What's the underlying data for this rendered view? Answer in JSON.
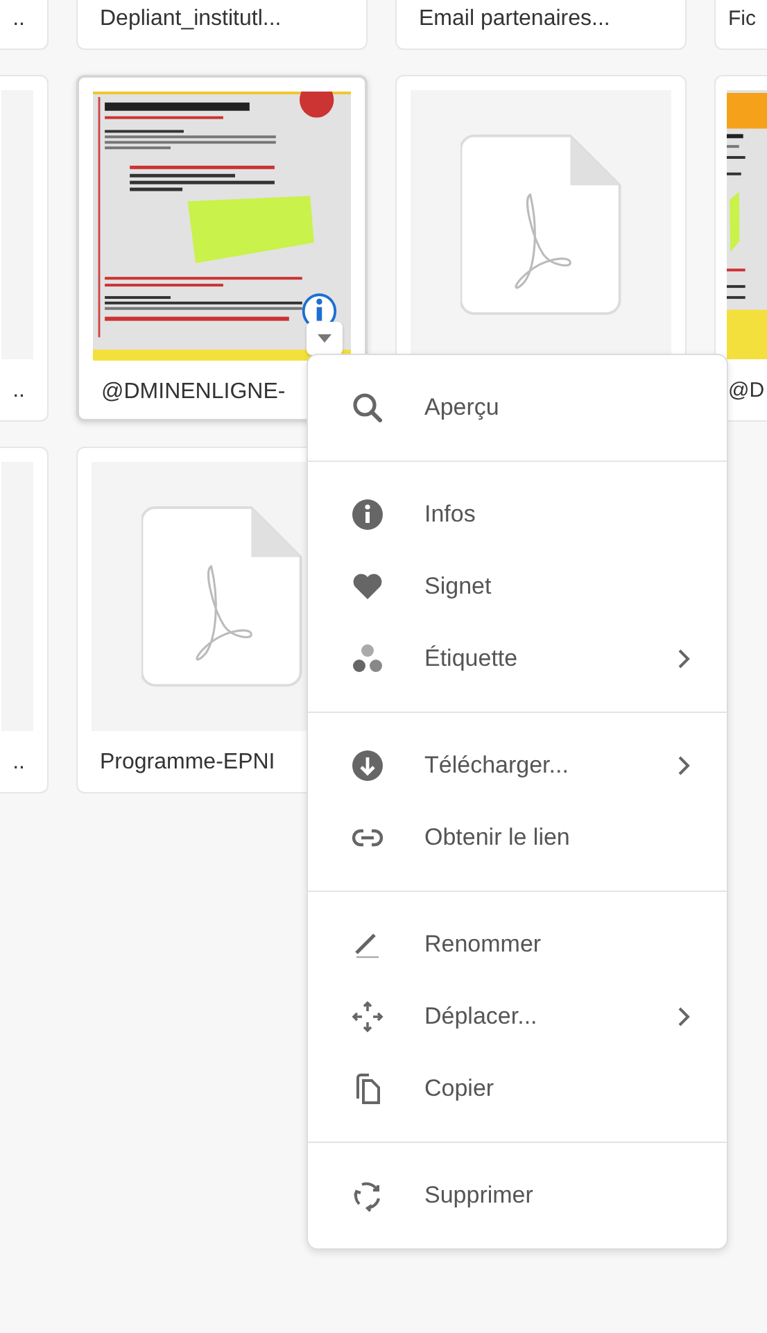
{
  "file_grid": {
    "rows": [
      {
        "cards": [
          {
            "caption": "..",
            "selected": false
          },
          {
            "caption": "Depliant_institutl...",
            "selected": false
          },
          {
            "caption": "Email partenaires...",
            "selected": false
          },
          {
            "caption": "Fic",
            "selected": false
          }
        ]
      },
      {
        "cards": [
          {
            "caption": "..",
            "kind": "blank",
            "selected": false
          },
          {
            "caption": "@DMINENLIGNE-",
            "kind": "poster",
            "selected": true
          },
          {
            "kind": "pdf",
            "selected": false
          },
          {
            "caption": "@D",
            "kind": "poster_orange",
            "selected": false
          }
        ]
      },
      {
        "cards": [
          {
            "caption": "..",
            "kind": "blank",
            "selected": false
          },
          {
            "caption": "Programme-EPNI",
            "kind": "pdf",
            "selected": false
          }
        ]
      }
    ]
  },
  "context_menu": {
    "sections": [
      {
        "items": [
          {
            "label": "Aperçu",
            "has_submenu": false
          }
        ]
      },
      {
        "items": [
          {
            "label": "Infos",
            "has_submenu": false
          },
          {
            "label": "Signet",
            "has_submenu": false
          },
          {
            "label": "Étiquette",
            "has_submenu": true
          }
        ]
      },
      {
        "items": [
          {
            "label": "Télécharger...",
            "has_submenu": true
          },
          {
            "label": "Obtenir le lien",
            "has_submenu": false
          }
        ]
      },
      {
        "items": [
          {
            "label": "Renommer",
            "has_submenu": false
          },
          {
            "label": "Déplacer...",
            "has_submenu": true
          },
          {
            "label": "Copier",
            "has_submenu": false
          }
        ]
      },
      {
        "items": [
          {
            "label": "Supprimer",
            "has_submenu": false
          }
        ]
      }
    ]
  }
}
